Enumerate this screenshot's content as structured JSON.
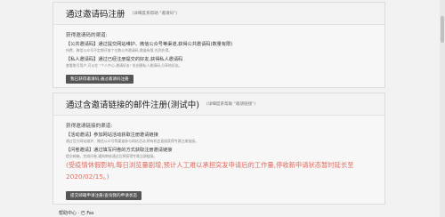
{
  "invite_code": {
    "title": "通过邀请码注册",
    "hint": "(详细度系帮助 \"邀请码\")",
    "section_label": "获得邀请码的渠道:",
    "items": [
      {
        "title": "【公共邀请码】通过提交网站维护、微信公众号等渠道,获得公共邀请码(数量有限)",
        "desc": "持费、微信公众号不定期开放个位数公共邀请码,数量有限,先到先得。"
      },
      {
        "title": "【私人邀请码】通过已经注册提交的好友,获得私人邀请码",
        "desc": "查看账号用户,可以在 \"个人中心-邀请好友\" 处创建私人邀请码,分享给好友。"
      }
    ],
    "button": "我已获得邀请码,通过邀请码注册"
  },
  "invite_link": {
    "title": "通过含邀请链接的邮件注册(测试中)",
    "hint": "(详细度系帮助 \"邀请链接\")",
    "section_label": "获得邀请链接的渠道:",
    "items": [
      {
        "title": "【活动邀请】参加网站活动获取注册邀请链接",
        "desc": "通过官方网站维护、微信公众号等渠道参与网站活动,将有机会直接获得专属注册链接。"
      },
      {
        "title": "【问卷邀请】通过填写问卷的方式获取注册邀请链接",
        "desc": "提交邮箱、完成问卷,通知审核通过后将获得专属注册链接。"
      }
    ],
    "notice": "(受疫情休假影响,每日浏览量剧增,预计人工难以承担突发申请后的工作量,停收新申请状态暂时延长至2020/02/15。)",
    "button": "提交邮箱申请注册/查询我的申请状态"
  },
  "footer": {
    "text": "帮助中心  · 已 Fas"
  }
}
